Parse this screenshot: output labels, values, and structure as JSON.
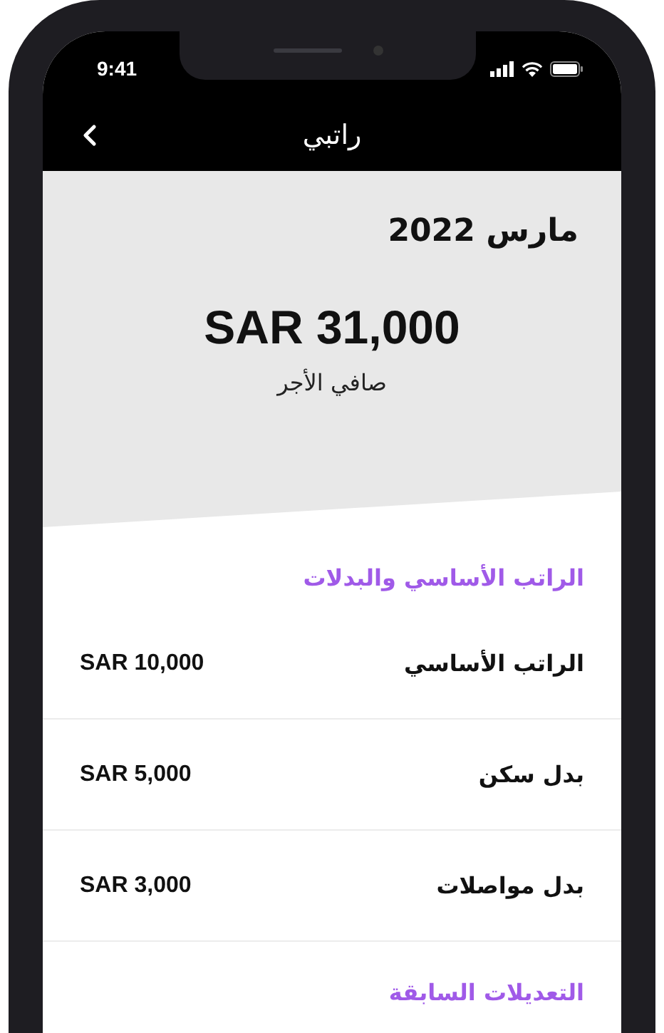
{
  "status_bar": {
    "time": "9:41"
  },
  "header": {
    "title": "راتبي"
  },
  "summary": {
    "month": "مارس 2022",
    "amount": "SAR 31,000",
    "amount_label": "صافي الأجر"
  },
  "sections": [
    {
      "title": "الراتب الأساسي والبدلات",
      "rows": [
        {
          "label": "الراتب الأساسي",
          "value": "SAR 10,000"
        },
        {
          "label": "بدل سكن",
          "value": "SAR 5,000"
        },
        {
          "label": "بدل مواصلات",
          "value": "SAR 3,000"
        }
      ]
    },
    {
      "title": "التعديلات السابقة"
    }
  ]
}
